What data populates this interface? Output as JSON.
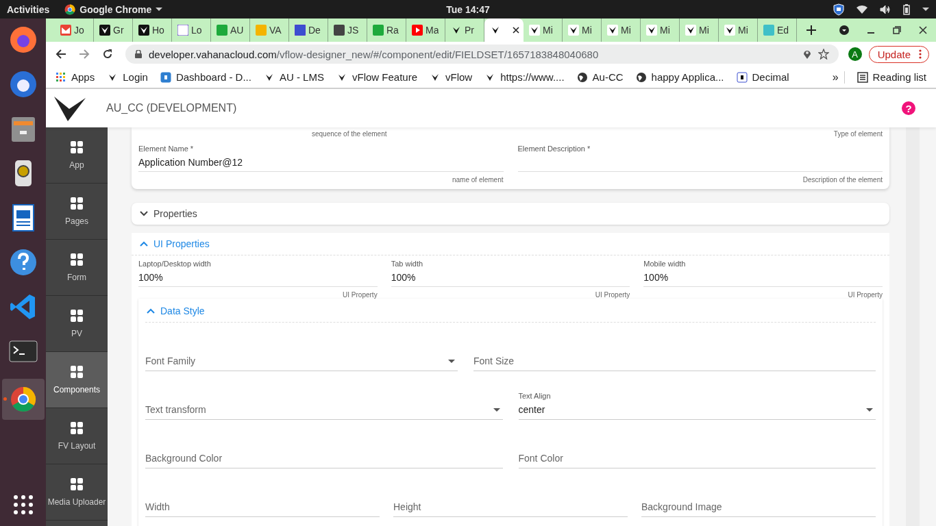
{
  "top_bar": {
    "activities": "Activities",
    "app_name": "Google Chrome",
    "clock": "Tue 14:47"
  },
  "dock": [
    {
      "kind": "firefox",
      "selected": false
    },
    {
      "kind": "mail",
      "selected": false
    },
    {
      "kind": "files",
      "selected": false
    },
    {
      "kind": "speaker",
      "selected": false
    },
    {
      "kind": "writer",
      "selected": false
    },
    {
      "kind": "help",
      "selected": false
    },
    {
      "kind": "code",
      "selected": false
    },
    {
      "kind": "terminal",
      "selected": false
    },
    {
      "kind": "chrome",
      "selected": true
    }
  ],
  "tabs": [
    {
      "kind": "gmail",
      "label": "Jo",
      "selected": false
    },
    {
      "kind": "vbox",
      "label": "Gr",
      "selected": false
    },
    {
      "kind": "vbox",
      "label": "Ho",
      "selected": false
    },
    {
      "kind": "dlogo",
      "label": "Lo",
      "selected": false
    },
    {
      "kind": "chat",
      "label": "AU",
      "selected": false
    },
    {
      "kind": "slides",
      "label": "VA",
      "selected": false
    },
    {
      "kind": "decimal",
      "label": "De",
      "selected": false
    },
    {
      "kind": "json",
      "label": "JS",
      "selected": false
    },
    {
      "kind": "chat",
      "label": "Ra",
      "selected": false
    },
    {
      "kind": "youtube",
      "label": "Ma",
      "selected": false
    },
    {
      "kind": "vmark",
      "label": "Pr",
      "selected": false
    },
    {
      "kind": "vmark",
      "selected": true
    },
    {
      "kind": "vwhite",
      "label": "Mi",
      "selected": false
    },
    {
      "kind": "vwhite",
      "label": "Mi",
      "selected": false
    },
    {
      "kind": "vwhite",
      "label": "Mi",
      "selected": false
    },
    {
      "kind": "vwhite",
      "label": "Mi",
      "selected": false
    },
    {
      "kind": "vwhite",
      "label": "Mi",
      "selected": false
    },
    {
      "kind": "vwhite",
      "label": "Mi",
      "selected": false
    },
    {
      "kind": "edit",
      "label": "Ed",
      "selected": false
    }
  ],
  "address_bar": {
    "host": "developer.vahanacloud.com",
    "path": "/vflow-designer_new/#/component/edit/FIELDSET/1657183848040680",
    "profile": "A",
    "update": "Update"
  },
  "bookmarks": [
    {
      "kind": "apps",
      "label": "Apps"
    },
    {
      "kind": "vsmall",
      "label": "Login"
    },
    {
      "kind": "hr",
      "label": "Dashboard - D..."
    },
    {
      "kind": "vmark",
      "label": "AU - LMS"
    },
    {
      "kind": "vmark",
      "label": "vFlow Feature"
    },
    {
      "kind": "vmark",
      "label": "vFlow"
    },
    {
      "kind": "vmark",
      "label": "https://www...."
    },
    {
      "kind": "globe",
      "label": "Au-CC"
    },
    {
      "kind": "globe",
      "label": "happy Applica..."
    },
    {
      "kind": "decimal",
      "label": "Decimal"
    }
  ],
  "bookmarks_more": "»",
  "reading_list": "Reading list",
  "app_header": {
    "title": "AU_CC (DEVELOPMENT)",
    "help": "?"
  },
  "sidebar": [
    {
      "label": "App",
      "selected": false
    },
    {
      "label": "Pages",
      "selected": false
    },
    {
      "label": "Form",
      "selected": false
    },
    {
      "label": "PV",
      "selected": false
    },
    {
      "label": "Components",
      "selected": true
    },
    {
      "label": "FV Layout",
      "selected": false
    },
    {
      "label": "Media Uploader",
      "selected": false
    }
  ],
  "element_card": {
    "hints": [
      "sequence of the element",
      "Type of element"
    ],
    "fields": [
      {
        "label": "Element Name *",
        "value": "Application Number@12",
        "hint": "name of element"
      },
      {
        "label": "Element Description *",
        "hint": "Description of the element"
      }
    ]
  },
  "sections": [
    {
      "title": "Properties",
      "expanded": false
    },
    {
      "title": "UI Properties",
      "expanded": true
    }
  ],
  "ui_fields": [
    {
      "label": "Laptop/Desktop width",
      "value": "100%",
      "hint": "UI Property"
    },
    {
      "label": "Tab width",
      "value": "100%",
      "hint": "UI Property"
    },
    {
      "label": "Mobile width",
      "value": "100%",
      "hint": "UI Property"
    }
  ],
  "data_style": {
    "title": "Data Style",
    "expanded": true,
    "rows": [
      [
        {
          "placeholder": "Font Family",
          "dropdown": true
        },
        {
          "placeholder": "Font Size",
          "dropdown": false
        }
      ],
      [
        {
          "placeholder": "Text transform",
          "dropdown": true
        },
        {
          "label": "Text Align",
          "value": "center",
          "dropdown": true
        }
      ],
      [
        {
          "placeholder": "Background Color",
          "dropdown": false
        },
        {
          "placeholder": "Font Color",
          "dropdown": false
        }
      ],
      [
        {
          "placeholder": "Width",
          "dropdown": false
        },
        {
          "placeholder": "Height",
          "dropdown": false
        },
        {
          "placeholder": "Background Image",
          "dropdown": false
        }
      ]
    ]
  }
}
